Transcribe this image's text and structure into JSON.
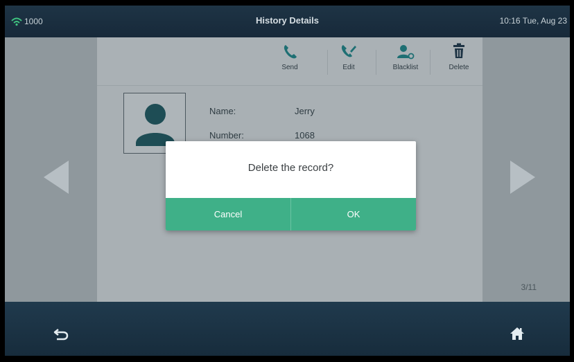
{
  "status_bar": {
    "line_label": "1000",
    "title": "History Details",
    "clock": "10:16 Tue, Aug 23"
  },
  "toolbar": {
    "items": [
      {
        "label": "Send",
        "icon": "phone-icon"
      },
      {
        "label": "Edit",
        "icon": "edit-call-icon"
      },
      {
        "label": "Blacklist",
        "icon": "blacklist-icon"
      },
      {
        "label": "Delete",
        "icon": "trash-icon"
      }
    ]
  },
  "contact": {
    "name_label": "Name:",
    "name_value": "Jerry",
    "number_label": "Number:",
    "number_value": "1068"
  },
  "pagination": "3/11",
  "dialog": {
    "message": "Delete the record?",
    "cancel_label": "Cancel",
    "ok_label": "OK"
  },
  "colors": {
    "accent": "#3fb088",
    "icon_teal": "#1e6f73",
    "bar": "#1a2f40",
    "signal_green": "#3fc27f"
  }
}
